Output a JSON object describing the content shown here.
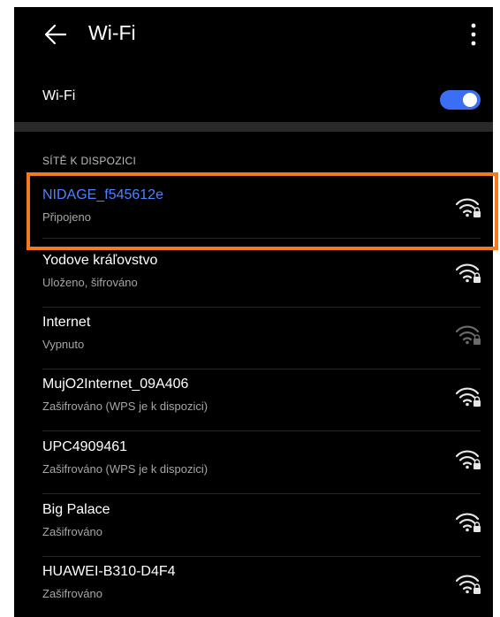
{
  "header": {
    "title": "Wi-Fi"
  },
  "wifi_toggle": {
    "label": "Wi-Fi",
    "enabled": true
  },
  "section_title": "SÍTĚ K DISPOZICI",
  "colors": {
    "background": "#000000",
    "connected_name": "#4f82ff",
    "toggle_on": "#3a6ff5",
    "highlight_border": "#f47a20"
  },
  "networks": [
    {
      "name": "NIDAGE_f545612e",
      "status": "Připojeno",
      "icon": "wifi-lock-icon"
    },
    {
      "name": "Yodove kráľovstvo",
      "status": "Uloženo, šifrováno",
      "icon": "wifi-lock-icon"
    },
    {
      "name": "Internet",
      "status": "Vypnuto",
      "icon": "wifi-lock-icon"
    },
    {
      "name": "MujO2Internet_09A406",
      "status": "Zašifrováno (WPS je k dispozici)",
      "icon": "wifi-lock-icon"
    },
    {
      "name": "UPC4909461",
      "status": "Zašifrováno (WPS je k dispozici)",
      "icon": "wifi-lock-icon"
    },
    {
      "name": "Big Palace",
      "status": "Zašifrováno",
      "icon": "wifi-lock-icon"
    },
    {
      "name": "HUAWEI-B310-D4F4",
      "status": "Zašifrováno",
      "icon": "wifi-lock-icon"
    }
  ]
}
